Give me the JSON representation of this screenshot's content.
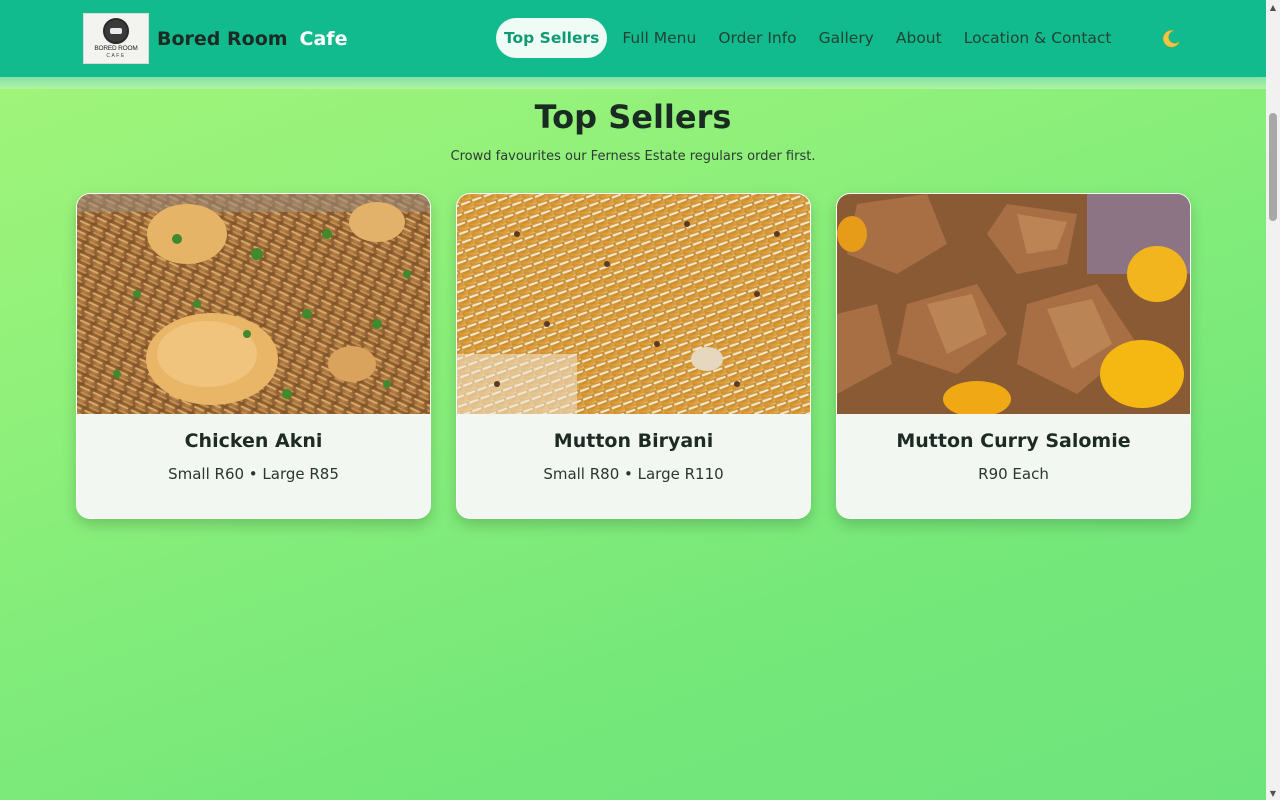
{
  "header": {
    "logo": {
      "icon": "bored-room-cafe-logo",
      "line1": "BORED ROOM",
      "line2": "CAFE"
    },
    "brand_name": "Bored Room",
    "brand_suffix": "Cafe",
    "nav": [
      {
        "label": "Top Sellers",
        "active": true
      },
      {
        "label": "Full Menu",
        "active": false
      },
      {
        "label": "Order Info",
        "active": false
      },
      {
        "label": "Gallery",
        "active": false
      },
      {
        "label": "About",
        "active": false
      },
      {
        "label": "Location & Contact",
        "active": false
      }
    ],
    "theme_toggle_icon": "moon-icon"
  },
  "section": {
    "title": "Top Sellers",
    "subtitle": "Crowd favourites our Ferness Estate regulars order first."
  },
  "products": [
    {
      "name": "Chicken Akni",
      "price": "Small R60 • Large R85",
      "image": "chicken-akni-photo"
    },
    {
      "name": "Mutton Biryani",
      "price": "Small R80 • Large R110",
      "image": "mutton-biryani-photo"
    },
    {
      "name": "Mutton Curry Salomie",
      "price": "R90 Each",
      "image": "mutton-curry-photo"
    }
  ],
  "colors": {
    "header_bg": "#12bb8e",
    "active_nav_text": "#0f9a74",
    "page_bg_start": "#a4f57a",
    "page_bg_end": "#6ee47c",
    "card_bg": "#f2f7f2"
  },
  "scrollbar": {
    "position": 0.14
  }
}
